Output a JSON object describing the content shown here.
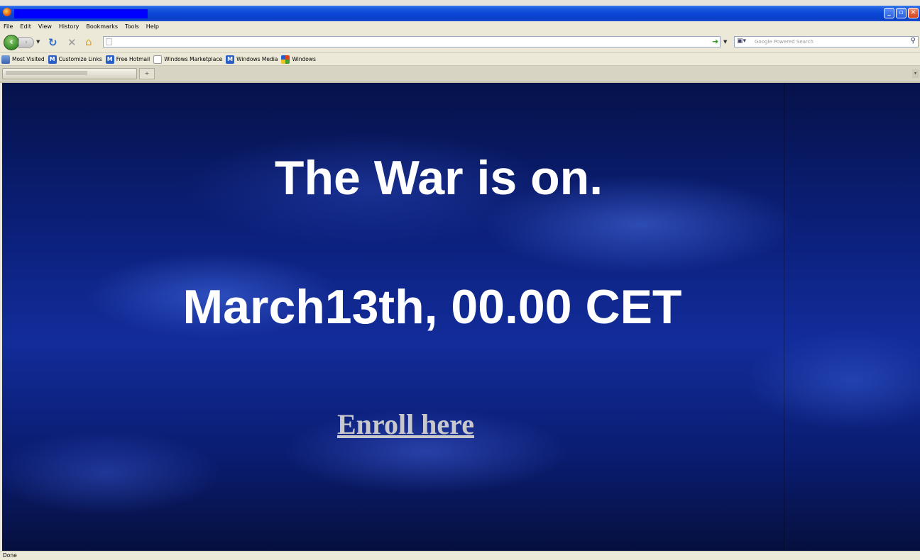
{
  "window": {
    "title": "",
    "buttons": {
      "minimize": "_",
      "maximize": "▫",
      "close": "✕"
    }
  },
  "menu": [
    {
      "label": "File"
    },
    {
      "label": "Edit"
    },
    {
      "label": "View"
    },
    {
      "label": "History"
    },
    {
      "label": "Bookmarks"
    },
    {
      "label": "Tools"
    },
    {
      "label": "Help"
    }
  ],
  "navigation": {
    "back_icon": "back-arrow-icon",
    "forward_icon": "forward-arrow-icon",
    "reload_icon": "reload-icon",
    "stop_icon": "stop-icon",
    "home_icon": "home-icon",
    "url_value": "",
    "search_placeholder": "Google Powered Search"
  },
  "bookmarks": [
    {
      "label": "Most Visited",
      "icon": "folder-icon"
    },
    {
      "label": "Customize Links",
      "icon": "msn-icon"
    },
    {
      "label": "Free Hotmail",
      "icon": "msn-icon"
    },
    {
      "label": "Windows Marketplace",
      "icon": "page-icon"
    },
    {
      "label": "Windows Media",
      "icon": "msn-icon"
    },
    {
      "label": "Windows",
      "icon": "windows-icon"
    }
  ],
  "tabs": [
    {
      "label": ""
    }
  ],
  "content": {
    "headline": "The War is on.",
    "date": "March13th, 00.00 CET",
    "link": "Enroll here"
  },
  "status": {
    "text": "Done"
  },
  "colors": {
    "titlebar": "#0a46d6",
    "chrome": "#ece9d8",
    "content_bg": "#0b1f78",
    "headline": "#ffffff",
    "link": "#c8c8cc"
  }
}
